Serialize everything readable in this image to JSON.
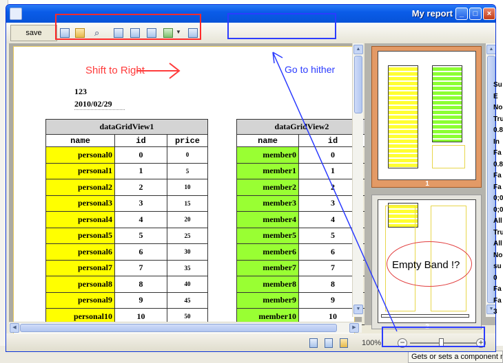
{
  "window": {
    "title": "My report"
  },
  "toolbar": {
    "save_label": "save"
  },
  "annotations": {
    "shift_right": "Shift to Right",
    "go_hither": "Go to hither",
    "empty_band": "Empty Band !?"
  },
  "report": {
    "text1": "123",
    "text2": "2010/02/29",
    "grid1": {
      "title": "dataGridView1",
      "columns": [
        "name",
        "id",
        "price"
      ],
      "rows": [
        [
          "personal0",
          "0",
          "0"
        ],
        [
          "personal1",
          "1",
          "5"
        ],
        [
          "personal2",
          "2",
          "10"
        ],
        [
          "personal3",
          "3",
          "15"
        ],
        [
          "personal4",
          "4",
          "20"
        ],
        [
          "personal5",
          "5",
          "25"
        ],
        [
          "personal6",
          "6",
          "30"
        ],
        [
          "personal7",
          "7",
          "35"
        ],
        [
          "personal8",
          "8",
          "40"
        ],
        [
          "personal9",
          "9",
          "45"
        ],
        [
          "personal10",
          "10",
          "50"
        ]
      ]
    },
    "grid2": {
      "title": "dataGridView2",
      "columns": [
        "name",
        "id"
      ],
      "rows": [
        [
          "member0",
          "0"
        ],
        [
          "member1",
          "1"
        ],
        [
          "member2",
          "2"
        ],
        [
          "member3",
          "3"
        ],
        [
          "member4",
          "4"
        ],
        [
          "member5",
          "5"
        ],
        [
          "member6",
          "6"
        ],
        [
          "member7",
          "7"
        ],
        [
          "member8",
          "8"
        ],
        [
          "member9",
          "9"
        ],
        [
          "member10",
          "10"
        ]
      ]
    },
    "colors": {
      "grid1_name_bg": "#ffff00",
      "grid2_name_bg": "#99ff33"
    }
  },
  "thumbnails": [
    {
      "label": "1"
    },
    {
      "label": "2"
    }
  ],
  "status": {
    "zoom": "100%"
  },
  "background": {
    "tooltip": "Gets or sets a component n",
    "right_column": [
      "Su",
      "E",
      "No",
      "Tru",
      "0.8",
      "In",
      "Fa",
      "0.8",
      "Fa",
      "Fa",
      "0;0",
      "0;0",
      "All",
      "Tru",
      "All",
      "No",
      "su",
      "0",
      "Fa",
      "Fa",
      "3"
    ]
  }
}
